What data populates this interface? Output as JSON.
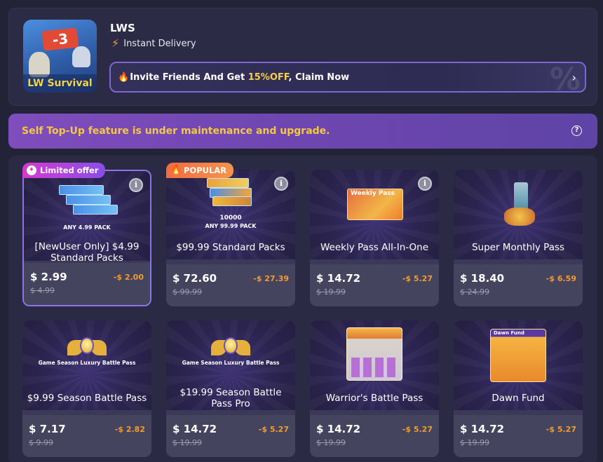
{
  "game": {
    "icon_text_badge": "-3",
    "icon_brand": "LW Survival",
    "name": "LWS",
    "delivery": "Instant Delivery"
  },
  "invite": {
    "prefix": "Invite Friends And Get ",
    "highlight": "15%OFF",
    "suffix": ", Claim Now",
    "deco": "%"
  },
  "banner": {
    "message": "Self Top-Up feature is under maintenance and upgrade."
  },
  "products": [
    {
      "title": "[NewUser Only] $4.99 Standard Packs",
      "art_label": "ANY 4.99 PACK",
      "price": "$ 2.99",
      "original": "$ 4.99",
      "discount": "-$ 2.00",
      "badge": "Limited offer",
      "info": true
    },
    {
      "title": "$99.99 Standard Packs",
      "art_label_top": "10000",
      "art_label": "ANY 99.99 PACK",
      "price": "$ 72.60",
      "original": "$ 99.99",
      "discount": "-$ 27.39",
      "badge": "POPULAR",
      "info": true
    },
    {
      "title": "Weekly Pass All-In-One",
      "art_label": "Weekly Pass",
      "price": "$ 14.72",
      "original": "$ 19.99",
      "discount": "-$ 5.27",
      "info": true
    },
    {
      "title": "Super Monthly Pass",
      "price": "$ 18.40",
      "original": "$ 24.99",
      "discount": "-$ 6.59"
    },
    {
      "title": "$9.99 Season Battle Pass",
      "art_label": "Game Season Luxury Battle Pass",
      "price": "$ 7.17",
      "original": "$ 9.99",
      "discount": "-$ 2.82"
    },
    {
      "title": "$19.99 Season Battle Pass Pro",
      "art_label": "Game Season Luxury Battle Pass",
      "price": "$ 14.72",
      "original": "$ 19.99",
      "discount": "-$ 5.27"
    },
    {
      "title": "Warrior's Battle Pass",
      "price": "$ 14.72",
      "original": "$ 19.99",
      "discount": "-$ 5.27"
    },
    {
      "title": "Dawn Fund",
      "art_label": "Dawn Fund",
      "price": "$ 14.72",
      "original": "$ 19.99",
      "discount": "-$ 5.27"
    }
  ],
  "icons": {
    "info": "i",
    "help": "?",
    "chevron": "›",
    "bolt": "⚡",
    "fire": "🔥"
  },
  "colors": {
    "accent_gold": "#f6d046",
    "discount": "#f39b2f",
    "banner": "#7f4dbc",
    "selected_border": "#8d73e6"
  }
}
